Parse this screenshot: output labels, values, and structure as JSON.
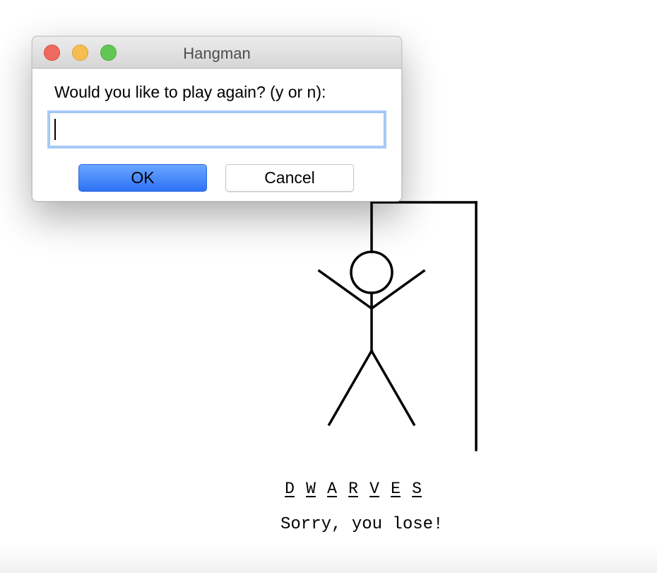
{
  "dialog": {
    "title": "Hangman",
    "prompt": "Would you like to play again? (y or n):",
    "input_value": "",
    "ok_label": "OK",
    "cancel_label": "Cancel"
  },
  "game": {
    "word_letters": [
      "D",
      "W",
      "A",
      "R",
      "V",
      "E",
      "S"
    ],
    "message": "Sorry, you lose!"
  },
  "colors": {
    "close": "#ee6a5f",
    "minimize": "#f6be50",
    "zoom": "#62c655",
    "ok_button": "#2e72f6",
    "focus_ring": "#a9cbf6"
  }
}
